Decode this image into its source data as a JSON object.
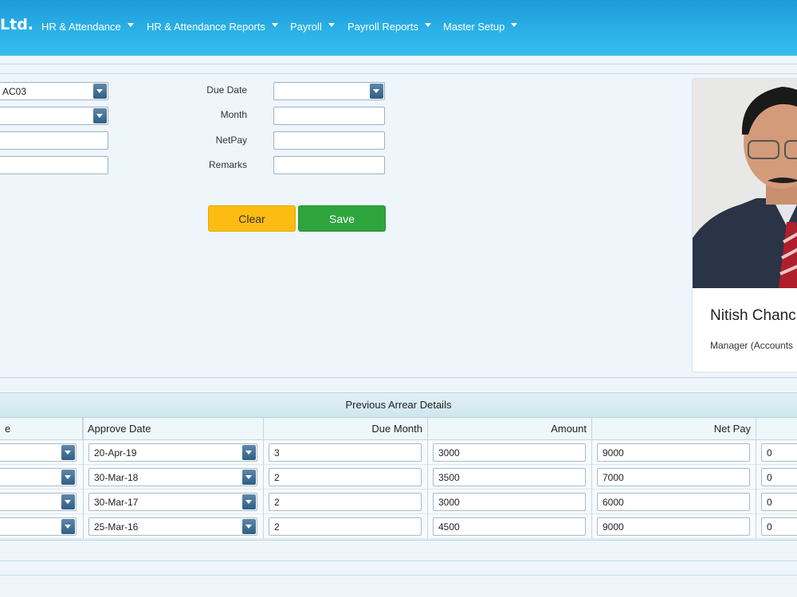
{
  "nav": {
    "brand": "Ltd.",
    "items": [
      {
        "label": "HR & Attendance"
      },
      {
        "label": "HR & Attendance Reports"
      },
      {
        "label": "Payroll"
      },
      {
        "label": "Payroll Reports"
      },
      {
        "label": "Master Setup"
      }
    ]
  },
  "form": {
    "employee_code_value": "AC03",
    "due_date": {
      "label": "Due Date",
      "value": ""
    },
    "month": {
      "label": "Month",
      "value": ""
    },
    "netpay": {
      "label": "NetPay",
      "value": ""
    },
    "remarks": {
      "label": "Remarks",
      "value": ""
    },
    "clear_label": "Clear",
    "save_label": "Save"
  },
  "profile": {
    "name": "Nitish Chanc",
    "title": "Manager (Accounts"
  },
  "grid": {
    "title": "Previous Arrear Details",
    "columns": [
      "e",
      "Approve Date",
      "Due Month",
      "Amount",
      "Net Pay"
    ],
    "rows": [
      {
        "approve_date": "20-Apr-19",
        "due_month": "3",
        "amount": "3000",
        "net_pay": "9000",
        "extra": "0"
      },
      {
        "approve_date": "30-Mar-18",
        "due_month": "2",
        "amount": "3500",
        "net_pay": "7000",
        "extra": "0"
      },
      {
        "approve_date": "30-Mar-17",
        "due_month": "2",
        "amount": "3000",
        "net_pay": "6000",
        "extra": "0"
      },
      {
        "approve_date": "25-Mar-16",
        "due_month": "2",
        "amount": "4500",
        "net_pay": "9000",
        "extra": "0"
      }
    ]
  }
}
